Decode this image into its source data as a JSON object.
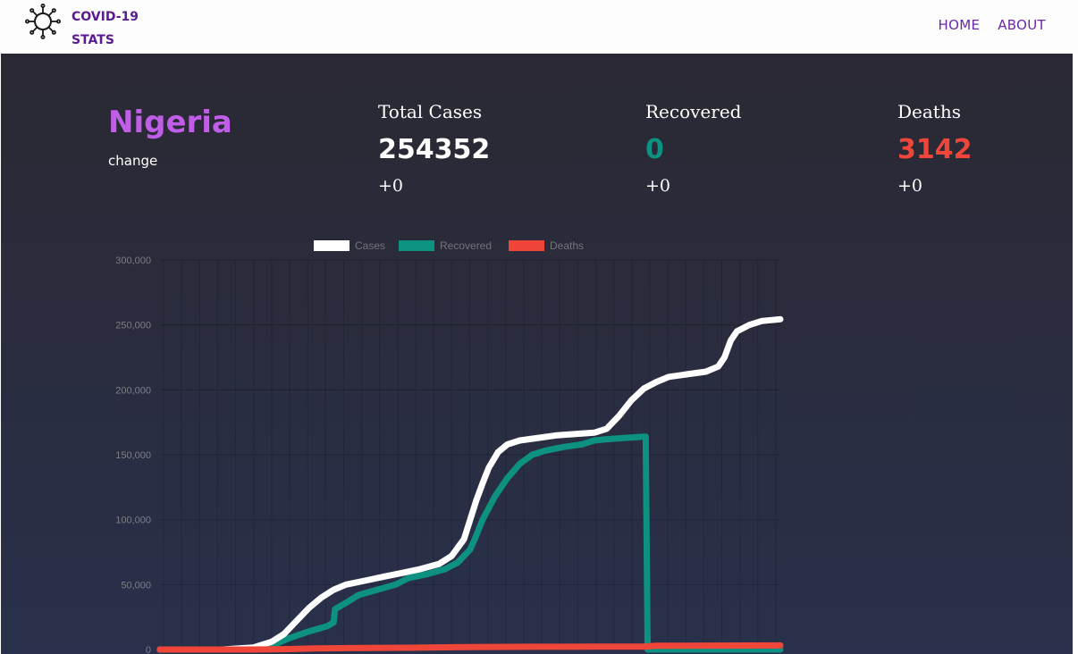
{
  "header": {
    "brand_line1": "COVID-19",
    "brand_line2": "STATS",
    "nav": [
      "HOME",
      "ABOUT"
    ],
    "brand_color": "#5b1a91"
  },
  "country": {
    "name": "Nigeria",
    "change_label": "change"
  },
  "stats": [
    {
      "label": "Total Cases",
      "value": "254352",
      "delta": "+0",
      "color": "#ffffff"
    },
    {
      "label": "Recovered",
      "value": "0",
      "delta": "+0",
      "color": "#0d9181"
    },
    {
      "label": "Deaths",
      "value": "3142",
      "delta": "+0",
      "color": "#f0463a"
    }
  ],
  "chart_data": {
    "type": "line",
    "ylim": [
      0,
      300000
    ],
    "yticks": [
      "0",
      "50,000",
      "100,000",
      "150,000",
      "200,000",
      "250,000",
      "300,000"
    ],
    "legend_position": "top",
    "grid": true,
    "series": [
      {
        "name": "Cases",
        "color": "#ffffff",
        "values": [
          [
            0,
            0
          ],
          [
            0.1,
            0
          ],
          [
            0.15,
            1500
          ],
          [
            0.18,
            6000
          ],
          [
            0.2,
            12000
          ],
          [
            0.22,
            22000
          ],
          [
            0.24,
            32000
          ],
          [
            0.26,
            40000
          ],
          [
            0.28,
            46000
          ],
          [
            0.3,
            50000
          ],
          [
            0.33,
            53000
          ],
          [
            0.36,
            56000
          ],
          [
            0.39,
            59000
          ],
          [
            0.42,
            62000
          ],
          [
            0.45,
            66000
          ],
          [
            0.47,
            72000
          ],
          [
            0.49,
            85000
          ],
          [
            0.5,
            100000
          ],
          [
            0.51,
            115000
          ],
          [
            0.52,
            128000
          ],
          [
            0.53,
            140000
          ],
          [
            0.545,
            152000
          ],
          [
            0.56,
            158000
          ],
          [
            0.58,
            161000
          ],
          [
            0.61,
            163000
          ],
          [
            0.64,
            165000
          ],
          [
            0.67,
            166000
          ],
          [
            0.7,
            167000
          ],
          [
            0.72,
            170000
          ],
          [
            0.74,
            180000
          ],
          [
            0.76,
            192000
          ],
          [
            0.78,
            201000
          ],
          [
            0.8,
            206000
          ],
          [
            0.82,
            210000
          ],
          [
            0.85,
            212000
          ],
          [
            0.88,
            214000
          ],
          [
            0.9,
            218000
          ],
          [
            0.91,
            225000
          ],
          [
            0.92,
            238000
          ],
          [
            0.93,
            245000
          ],
          [
            0.95,
            250000
          ],
          [
            0.97,
            253000
          ],
          [
            1.0,
            254352
          ]
        ]
      },
      {
        "name": "Recovered",
        "color": "#0d9181",
        "values": [
          [
            0,
            0
          ],
          [
            0.12,
            0
          ],
          [
            0.15,
            800
          ],
          [
            0.18,
            3000
          ],
          [
            0.21,
            9000
          ],
          [
            0.24,
            14000
          ],
          [
            0.27,
            18000
          ],
          [
            0.28,
            21000
          ],
          [
            0.282,
            31000
          ],
          [
            0.3,
            36000
          ],
          [
            0.32,
            42000
          ],
          [
            0.35,
            46000
          ],
          [
            0.38,
            50000
          ],
          [
            0.4,
            55000
          ],
          [
            0.43,
            58000
          ],
          [
            0.46,
            62000
          ],
          [
            0.48,
            67000
          ],
          [
            0.5,
            77000
          ],
          [
            0.51,
            88000
          ],
          [
            0.52,
            100000
          ],
          [
            0.54,
            118000
          ],
          [
            0.56,
            132000
          ],
          [
            0.58,
            143000
          ],
          [
            0.6,
            150000
          ],
          [
            0.62,
            153000
          ],
          [
            0.65,
            156000
          ],
          [
            0.68,
            158000
          ],
          [
            0.7,
            161000
          ],
          [
            0.72,
            162000
          ],
          [
            0.75,
            163000
          ],
          [
            0.78,
            164000
          ],
          [
            0.783,
            164000
          ],
          [
            0.786,
            0
          ],
          [
            1.0,
            0
          ]
        ]
      },
      {
        "name": "Deaths",
        "color": "#f0463a",
        "values": [
          [
            0,
            0
          ],
          [
            0.15,
            0
          ],
          [
            0.2,
            300
          ],
          [
            0.25,
            900
          ],
          [
            0.3,
            1100
          ],
          [
            0.4,
            1400
          ],
          [
            0.5,
            1900
          ],
          [
            0.6,
            2100
          ],
          [
            0.7,
            2200
          ],
          [
            0.78,
            2300
          ],
          [
            0.8,
            2900
          ],
          [
            0.9,
            3000
          ],
          [
            1.0,
            3142
          ]
        ]
      }
    ]
  }
}
